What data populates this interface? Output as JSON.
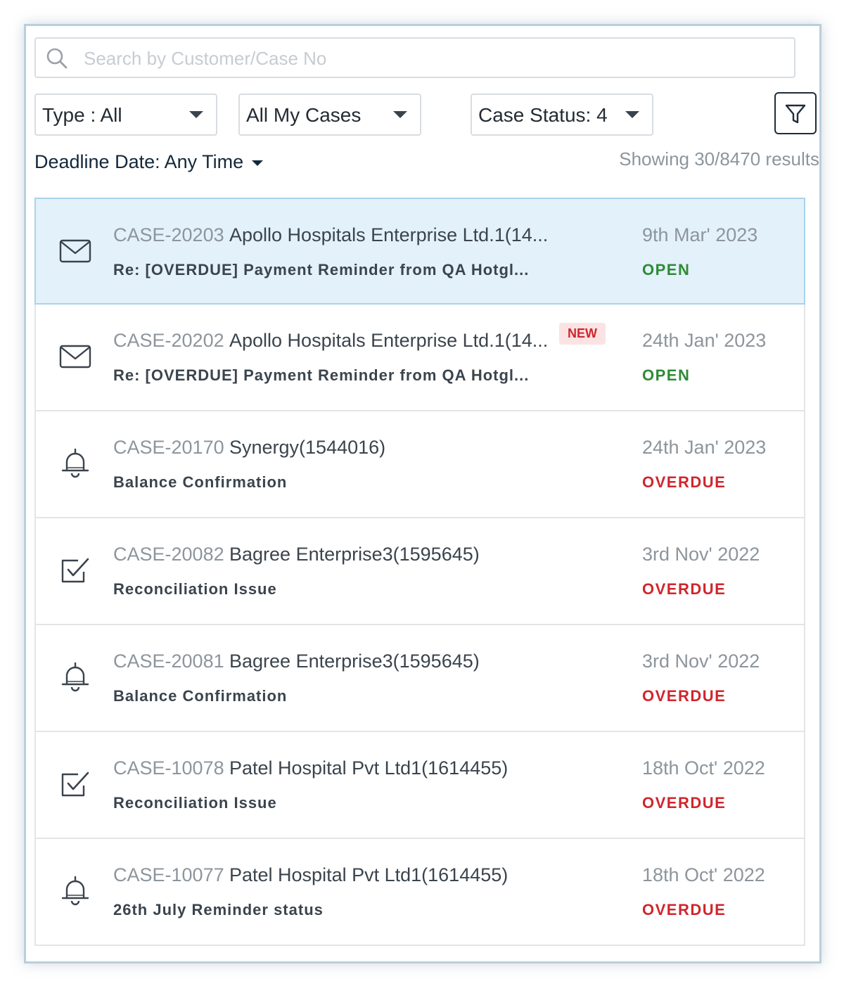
{
  "search": {
    "placeholder": "Search by Customer/Case No",
    "value": ""
  },
  "filters": {
    "type_label": "Type : All",
    "cases_label": "All My Cases",
    "status_label": "Case Status: 4",
    "deadline_label": "Deadline Date: Any Time"
  },
  "results_text": "Showing 30/8470 results",
  "colors": {
    "open": "#2e8b36",
    "overdue": "#d0262d",
    "selected_bg": "#e3f1fa",
    "badge_bg": "#fbe3e4"
  },
  "cases": [
    {
      "icon": "mail-icon",
      "case_no": "CASE-20203",
      "customer": "Apollo Hospitals Enterprise Ltd.1(14...",
      "subject": "Re: [OVERDUE] Payment Reminder from QA Hotgl...",
      "date": "9th Mar' 2023",
      "status": "OPEN",
      "badge": ""
    },
    {
      "icon": "mail-icon",
      "case_no": "CASE-20202",
      "customer": "Apollo Hospitals Enterprise Ltd.1(14...",
      "subject": "Re: [OVERDUE] Payment Reminder from QA Hotgl...",
      "date": "24th Jan' 2023",
      "status": "OPEN",
      "badge": "NEW"
    },
    {
      "icon": "bell-icon",
      "case_no": "CASE-20170",
      "customer": "Synergy(1544016)",
      "subject": "Balance Confirmation",
      "date": "24th Jan' 2023",
      "status": "OVERDUE",
      "badge": ""
    },
    {
      "icon": "checkbox-icon",
      "case_no": "CASE-20082",
      "customer": "Bagree Enterprise3(1595645)",
      "subject": "Reconciliation Issue",
      "date": "3rd Nov' 2022",
      "status": "OVERDUE",
      "badge": ""
    },
    {
      "icon": "bell-icon",
      "case_no": "CASE-20081",
      "customer": "Bagree Enterprise3(1595645)",
      "subject": "Balance Confirmation",
      "date": "3rd Nov' 2022",
      "status": "OVERDUE",
      "badge": ""
    },
    {
      "icon": "checkbox-icon",
      "case_no": "CASE-10078",
      "customer": "Patel Hospital Pvt Ltd1(1614455)",
      "subject": "Reconciliation Issue",
      "date": "18th Oct' 2022",
      "status": "OVERDUE",
      "badge": ""
    },
    {
      "icon": "bell-icon",
      "case_no": "CASE-10077",
      "customer": "Patel Hospital Pvt Ltd1(1614455)",
      "subject": "26th July Reminder status",
      "date": "18th Oct' 2022",
      "status": "OVERDUE",
      "badge": ""
    }
  ]
}
